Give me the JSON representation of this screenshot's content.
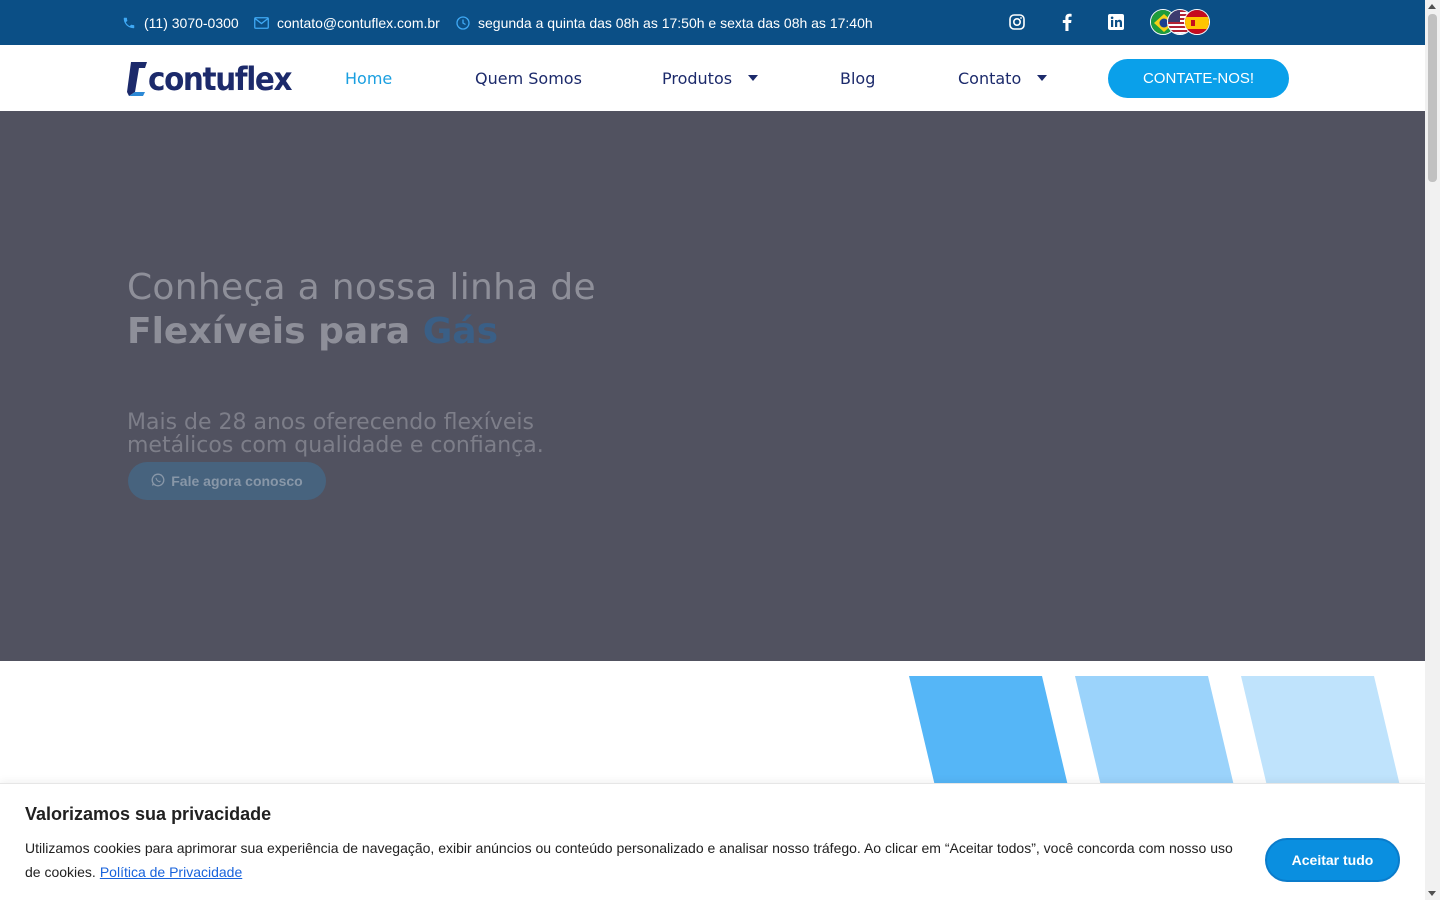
{
  "topbar": {
    "phone": "(11) 3070-0300",
    "email": "contato@contuflex.com.br",
    "hours": "segunda a quinta das 08h as 17:50h e sexta das 08h as 17:40h",
    "social_icons": [
      "instagram-icon",
      "facebook-icon",
      "linkedin-icon"
    ],
    "language_flags": [
      "flag-brazil",
      "flag-usa",
      "flag-spain"
    ]
  },
  "header": {
    "logo_text": "contuflex",
    "nav": [
      {
        "label": "Home",
        "active": true
      },
      {
        "label": "Quem Somos"
      },
      {
        "label": "Produtos",
        "dropdown": true
      },
      {
        "label": "Blog"
      },
      {
        "label": "Contato",
        "dropdown": true
      }
    ],
    "cta_label": "CONTATE-NOS!"
  },
  "hero": {
    "title_line1": "Conheça a nossa linha de",
    "title_line2_bold": "Flexíveis para",
    "title_line2_accent": "Gás",
    "subtitle": "Mais de 28 anos oferecendo flexíveis metálicos com qualidade e confiança.",
    "button_label": "Fale agora conosco"
  },
  "cookie": {
    "title": "Valorizamos sua privacidade",
    "text": "Utilizamos cookies para aprimorar sua experiência de navegação, exibir anúncios ou conteúdo personalizado e analisar nosso tráfego. Ao clicar em “Aceitar todos”, você concorda com nosso uso de cookies.",
    "link_label": "Política de Privacidade",
    "accept_label": "Aceitar tudo"
  },
  "colors": {
    "topbar_bg": "#0b4f86",
    "brand_navy": "#1c2a6b",
    "accent_blue": "#0aa0ea",
    "hero_overlay": "#515260"
  }
}
